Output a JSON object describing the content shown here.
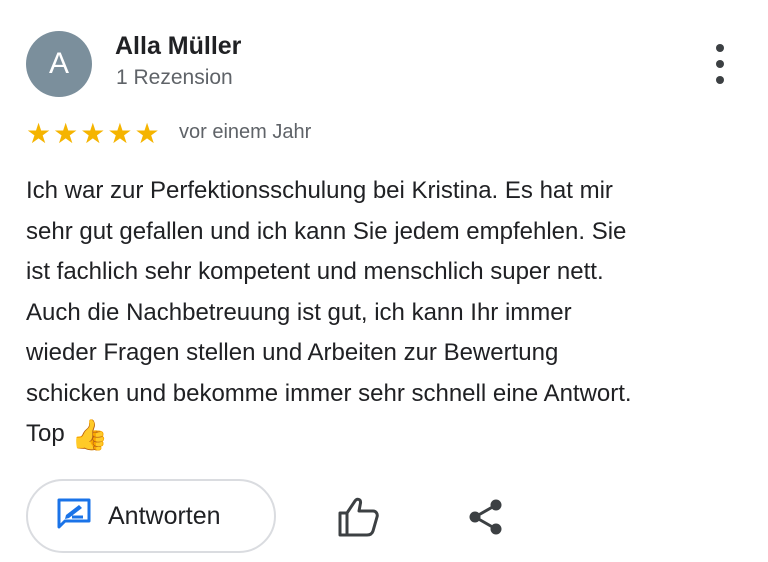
{
  "reviewer": {
    "initial": "A",
    "name": "Alla Müller",
    "review_count": "1 Rezension"
  },
  "rating": {
    "stars": 5,
    "max": 5,
    "time": "vor einem Jahr"
  },
  "review_lines": [
    "Ich war zur Perfektionsschulung bei Kristina. Es hat mir",
    "sehr gut gefallen und ich kann Sie jedem empfehlen. Sie",
    "ist fachlich sehr kompetent und menschlich super nett.",
    "Auch die Nachbetreuung ist gut, ich kann Ihr immer",
    "wieder Fragen stellen und Arbeiten zur Bewertung",
    "schicken und bekomme immer sehr schnell eine Antwort.",
    "Top"
  ],
  "review_emoji": "👍",
  "actions": {
    "reply_label": "Antworten",
    "reply_icon": "reply-edit-icon",
    "like_icon": "thumbs-up-icon",
    "share_icon": "share-icon",
    "more_icon": "more-vertical-icon"
  },
  "colors": {
    "avatar": "#7b8f9c",
    "star": "#f5b400",
    "accent": "#1a73e8",
    "text": "#202124",
    "secondary_text": "#5f6368"
  }
}
